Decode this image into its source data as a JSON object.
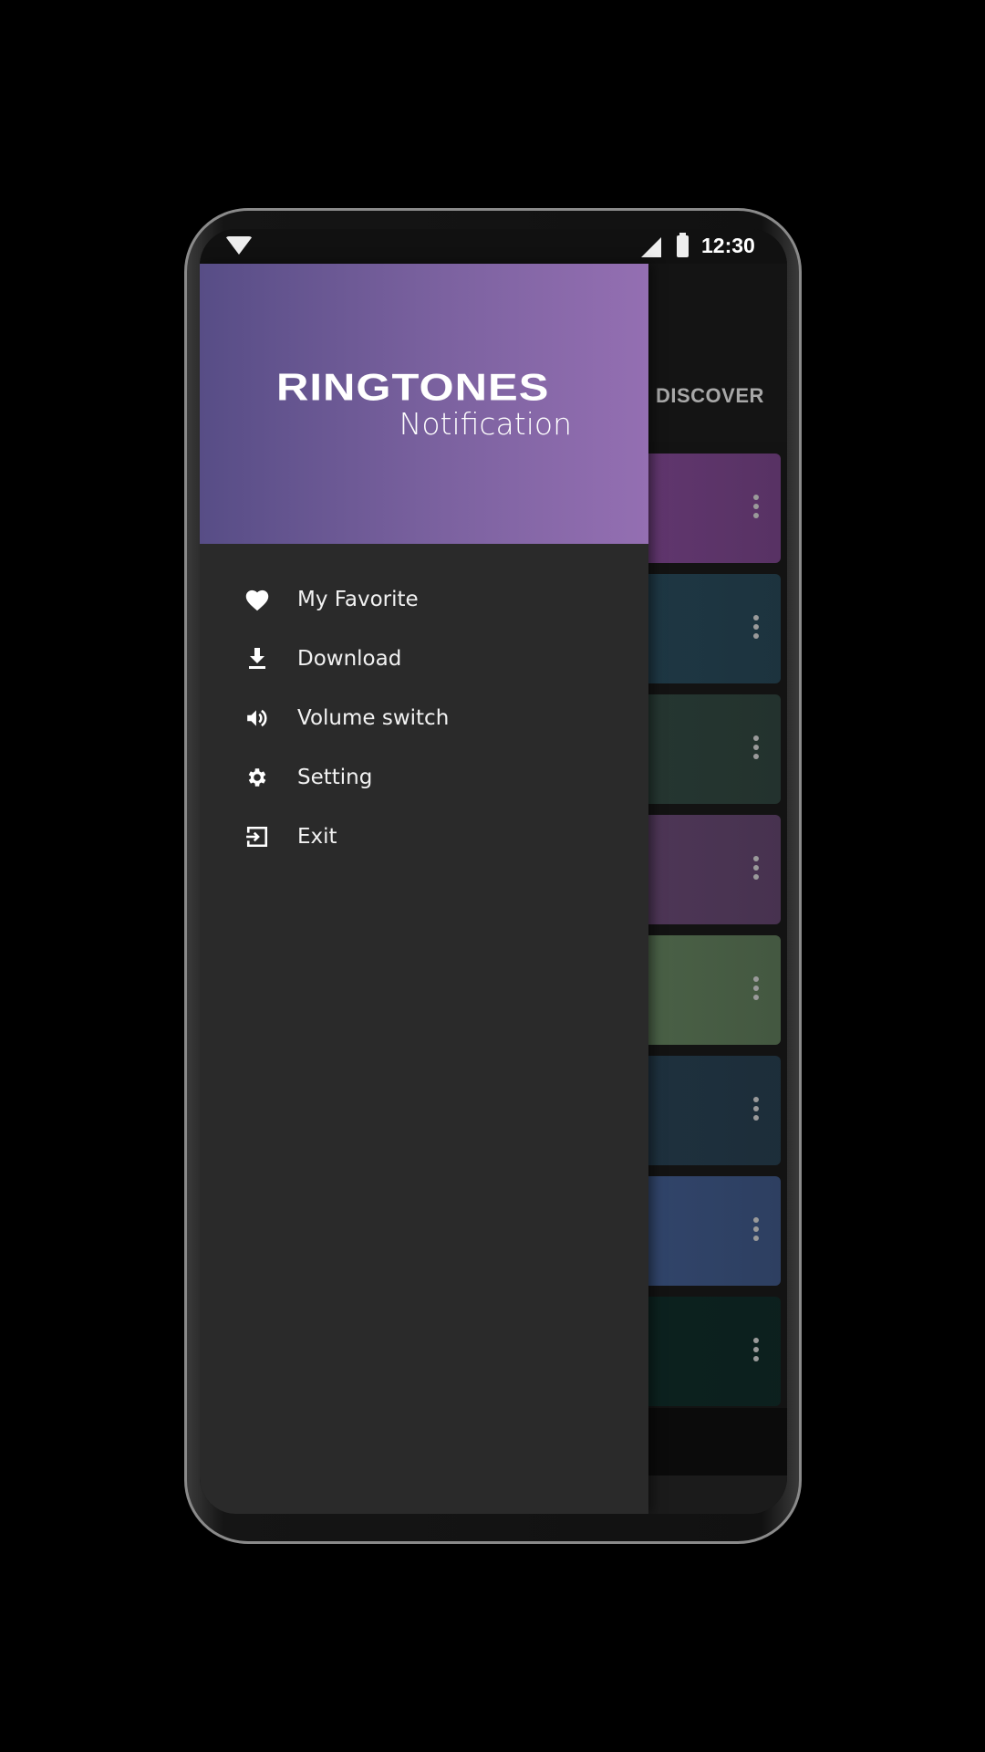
{
  "status_bar": {
    "time": "12:30",
    "icons": [
      "wifi-icon",
      "cell-signal-icon",
      "battery-icon"
    ]
  },
  "background_app": {
    "tab_label": "DISCOVER",
    "cards": [
      {
        "color": "#693a78"
      },
      {
        "color": "#1f3b49"
      },
      {
        "color": "#273a34"
      },
      {
        "color": "#543a5e"
      },
      {
        "color": "#50694c"
      },
      {
        "color": "#1f3443"
      },
      {
        "color": "#344a74"
      },
      {
        "color": "#0b2320"
      }
    ]
  },
  "drawer": {
    "logo": {
      "title": "RINGTONES",
      "subtitle": "Notification"
    },
    "header_gradient": [
      "#574d86",
      "#946fb2"
    ],
    "items": [
      {
        "label": "My Favorite",
        "icon": "heart-icon"
      },
      {
        "label": "Download",
        "icon": "download-icon"
      },
      {
        "label": "Volume switch",
        "icon": "volume-icon"
      },
      {
        "label": "Setting",
        "icon": "gear-icon"
      },
      {
        "label": "Exit",
        "icon": "exit-icon"
      }
    ]
  }
}
